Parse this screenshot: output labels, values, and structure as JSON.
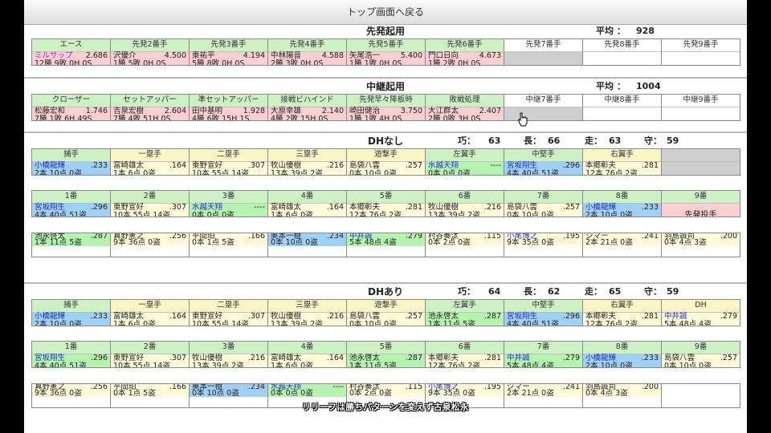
{
  "top_link": "トップ画面へ戻る",
  "starters": {
    "title": "先発起用",
    "avg_label": "平均 ：",
    "avg_value": "928",
    "cells": [
      {
        "header": "エース",
        "hc": "green",
        "bc": "pink",
        "name": "ミルサップ",
        "name_color": "magenta",
        "val1": "2.686",
        "line2": "12勝 9敗 0H 0S"
      },
      {
        "header": "先発2番手",
        "hc": "green",
        "bc": "pink",
        "name": "沢優介",
        "val1": "4.500",
        "line2": "1勝 5敗 0H 0S"
      },
      {
        "header": "先発3番手",
        "hc": "green",
        "bc": "pink",
        "name": "東祐平",
        "val1": "4.194",
        "line2": "5勝 8敗 0H 0S"
      },
      {
        "header": "先発4番手",
        "hc": "green",
        "bc": "pink",
        "name": "中林陽音",
        "val1": "4.588",
        "line2": "2勝 3敗 0H 0S"
      },
      {
        "header": "先発5番手",
        "hc": "green",
        "bc": "pink",
        "name": "矢尾浩一",
        "val1": "5.400",
        "line2": "1勝 1敗 0H 0S"
      },
      {
        "header": "先発6番手",
        "hc": "green",
        "bc": "pink",
        "name": "門口日向",
        "val1": "4.673",
        "line2": "1勝 2敗 0H 0S"
      },
      {
        "header": "先発7番手",
        "hc": "white",
        "bc": "gray",
        "name": "",
        "val1": "",
        "line2": ""
      },
      {
        "header": "先発8番手",
        "hc": "white",
        "bc": "white",
        "name": "",
        "val1": "",
        "line2": ""
      },
      {
        "header": "先発9番手",
        "hc": "white",
        "bc": "white",
        "name": "",
        "val1": "",
        "line2": ""
      }
    ]
  },
  "relievers": {
    "title": "中継起用",
    "avg_label": "平均 ：",
    "avg_value": "1004",
    "cells": [
      {
        "header": "クローザー",
        "hc": "green",
        "bc": "pink",
        "name": "松藤宏和",
        "val1": "1.746",
        "line2": "7勝 1敗 6H 49S"
      },
      {
        "header": "セットアッパー",
        "hc": "green",
        "bc": "pink",
        "name": "吉泉宏樹",
        "val1": "2.604",
        "line2": "7勝 4敗 51H 0S"
      },
      {
        "header": "準セットアッパー",
        "hc": "green",
        "bc": "pink",
        "name": "田中基明",
        "val1": "1.928",
        "line2": "4勝 6敗 15H 1S"
      },
      {
        "header": "接戦ビハインド",
        "hc": "green",
        "bc": "pink",
        "name": "大原幸雄",
        "val1": "2.140",
        "line2": "4勝 2敗 15H 0S"
      },
      {
        "header": "先発早々降板時",
        "hc": "green",
        "bc": "pink",
        "name": "崎田健治",
        "val1": "3.750",
        "line2": "1勝 1敗 4H 0S"
      },
      {
        "header": "敗戦処理",
        "hc": "green",
        "bc": "pink",
        "name": "大江群太",
        "val1": "2.407",
        "line2": "2勝 0敗 3H 0S"
      },
      {
        "header": "中継7番手",
        "hc": "white",
        "bc": "gray",
        "name": "",
        "val1": "",
        "line2": ""
      },
      {
        "header": "中継8番手",
        "hc": "white",
        "bc": "white",
        "name": "",
        "val1": "",
        "line2": ""
      },
      {
        "header": "中継9番手",
        "hc": "white",
        "bc": "white",
        "name": "",
        "val1": "",
        "line2": ""
      }
    ]
  },
  "dh_none": {
    "title": "DHなし",
    "stats": [
      {
        "label": "巧：",
        "value": "63"
      },
      {
        "label": "長：",
        "value": "66"
      },
      {
        "label": "走：",
        "value": "63"
      },
      {
        "label": "守：",
        "value": "59"
      }
    ],
    "positions": [
      {
        "header": "捕手",
        "hc": "green",
        "bc": "blue",
        "name": "小橋龍輝",
        "name_color": "blue",
        "val1": ".233",
        "line2": "2本 10点 0盗"
      },
      {
        "header": "一塁手",
        "hc": "yellow",
        "bc": "yellow",
        "name": "富崎雄太",
        "val1": ".164",
        "line2": "1本 6点 0盗"
      },
      {
        "header": "二塁手",
        "hc": "yellow",
        "bc": "yellow",
        "name": "東野宣好",
        "val1": ".307",
        "line2": "10本 55点 14盗"
      },
      {
        "header": "三塁手",
        "hc": "yellow",
        "bc": "yellow",
        "name": "牧山優樹",
        "val1": ".216",
        "line2": "13本 39点 2盗"
      },
      {
        "header": "遊撃手",
        "hc": "yellow",
        "bc": "yellow",
        "name": "島袋八雲",
        "val1": ".257",
        "line2": "0本 10点 0盗"
      },
      {
        "header": "左翼手",
        "hc": "green",
        "bc": "green",
        "name": "水越天翔",
        "name_color": "blue",
        "val1": "----",
        "line2": "0本 0点 0盗"
      },
      {
        "header": "中堅手",
        "hc": "green",
        "bc": "blue",
        "name": "宮坂翔生",
        "name_color": "blue",
        "val1": ".296",
        "line2": "4本 40点 51盗"
      },
      {
        "header": "右翼手",
        "hc": "yellow",
        "bc": "yellow",
        "name": "本郷彰夫",
        "val1": ".281",
        "line2": "12本 76点 2盗"
      },
      {
        "header": "",
        "hc": "gray",
        "bc": "gray",
        "name": "",
        "val1": "",
        "line2": ""
      }
    ],
    "order": [
      {
        "header": "1番",
        "hc": "green",
        "bc": "blue",
        "name": "宮坂翔生",
        "name_color": "blue",
        "val1": ".296",
        "line2": "4本 40点 51盗"
      },
      {
        "header": "2番",
        "hc": "green",
        "bc": "yellow",
        "name": "東野宣好",
        "val1": ".307",
        "line2": "10本 55点 14盗"
      },
      {
        "header": "3番",
        "hc": "green",
        "bc": "green",
        "name": "水越天翔",
        "name_color": "blue",
        "val1": "----",
        "line2": "0本 0点 0盗"
      },
      {
        "header": "4番",
        "hc": "green",
        "bc": "yellow",
        "name": "富崎雄太",
        "val1": ".164",
        "line2": "1本 6点 0盗"
      },
      {
        "header": "5番",
        "hc": "green",
        "bc": "yellow",
        "name": "本郷彰夫",
        "val1": ".281",
        "line2": "12本 76点 2盗"
      },
      {
        "header": "6番",
        "hc": "green",
        "bc": "yellow",
        "name": "牧山優樹",
        "val1": ".216",
        "line2": "13本 39点 2盗"
      },
      {
        "header": "7番",
        "hc": "green",
        "bc": "yellow",
        "name": "島袋八雲",
        "val1": ".257",
        "line2": "0本 10点 0盗"
      },
      {
        "header": "8番",
        "hc": "green",
        "bc": "blue",
        "name": "小橋龍輝",
        "name_color": "blue",
        "val1": ".233",
        "line2": "2本 10点 0盗"
      },
      {
        "header": "9番",
        "hc": "green",
        "bc": "pinkfull",
        "label": "先発投手"
      }
    ],
    "bench": [
      {
        "bc": "green",
        "name": "池永啓太",
        "val1": ".287",
        "line2": "1本 11点 5盗"
      },
      {
        "bc": "yellow",
        "name": "真野憲之",
        "val1": ".256",
        "line2": "9本 36点 0盗"
      },
      {
        "bc": "yellow",
        "name": "平間珀",
        "val1": ".166",
        "line2": "0本 1点 5盗"
      },
      {
        "bc": "blue",
        "name": "奥本一樹",
        "val1": ".234",
        "line2": "0本 10点 0盗"
      },
      {
        "bc": "green",
        "name": "中井誠",
        "name_color": "blue",
        "val1": ".279",
        "line2": "5本 48点 4盗"
      },
      {
        "bc": "yellow",
        "name": "村谷奏汰",
        "val1": ".115",
        "line2": "0本 2点 0盗"
      },
      {
        "bc": "yellow",
        "name": "小尾博之",
        "name_color": "blue",
        "val1": ".195",
        "line2": "9本 35点 0盗"
      },
      {
        "bc": "yellow",
        "name": "ジマー",
        "val1": ".241",
        "line2": "2本 21点 0盗"
      },
      {
        "bc": "yellow",
        "name": "羽島誠司",
        "val1": ".200",
        "line2": "0本 4点 3盗"
      }
    ]
  },
  "dh_yes": {
    "title": "DHあり",
    "stats": [
      {
        "label": "巧：",
        "value": "64"
      },
      {
        "label": "長：",
        "value": "62"
      },
      {
        "label": "走：",
        "value": "65"
      },
      {
        "label": "守：",
        "value": "59"
      }
    ],
    "positions": [
      {
        "header": "捕手",
        "hc": "green",
        "bc": "blue",
        "name": "小橋龍輝",
        "name_color": "blue",
        "val1": ".233",
        "line2": "2本 10点 0盗"
      },
      {
        "header": "一塁手",
        "hc": "yellow",
        "bc": "yellow",
        "name": "富崎雄太",
        "val1": ".164",
        "line2": "1本 6点 0盗"
      },
      {
        "header": "二塁手",
        "hc": "yellow",
        "bc": "yellow",
        "name": "東野宣好",
        "val1": ".307",
        "line2": "10本 55点 14盗"
      },
      {
        "header": "三塁手",
        "hc": "yellow",
        "bc": "yellow",
        "name": "牧山優樹",
        "val1": ".216",
        "line2": "13本 39点 2盗"
      },
      {
        "header": "遊撃手",
        "hc": "yellow",
        "bc": "yellow",
        "name": "島袋八雲",
        "val1": ".257",
        "line2": "0本 10点 0盗"
      },
      {
        "header": "左翼手",
        "hc": "green",
        "bc": "green",
        "name": "池永啓太",
        "val1": ".287",
        "line2": "1本 11点 5盗"
      },
      {
        "header": "中堅手",
        "hc": "green",
        "bc": "blue",
        "name": "宮坂翔生",
        "name_color": "blue",
        "val1": ".296",
        "line2": "4本 40点 51盗"
      },
      {
        "header": "右翼手",
        "hc": "yellow",
        "bc": "yellow",
        "name": "本郷彰夫",
        "val1": ".281",
        "line2": "12本 76点 2盗"
      },
      {
        "header": "DH",
        "hc": "yellow",
        "bc": "yellow",
        "name": "中井誠",
        "name_color": "blue",
        "val1": ".279",
        "line2": "5本 48点 4盗"
      }
    ],
    "order": [
      {
        "header": "1番",
        "hc": "green",
        "bc": "green",
        "name": "宮坂翔生",
        "name_color": "blue",
        "val1": ".296",
        "line2": "4本 40点 51盗"
      },
      {
        "header": "2番",
        "hc": "green",
        "bc": "yellow",
        "name": "東野宣好",
        "val1": ".307",
        "line2": "10本 55点 14盗"
      },
      {
        "header": "3番",
        "hc": "green",
        "bc": "yellow",
        "name": "牧山優樹",
        "val1": ".216",
        "line2": "13本 39点 2盗"
      },
      {
        "header": "4番",
        "hc": "green",
        "bc": "yellow",
        "name": "富崎雄太",
        "val1": ".164",
        "line2": "1本 6点 0盗"
      },
      {
        "header": "5番",
        "hc": "green",
        "bc": "green",
        "name": "池永啓太",
        "val1": ".287",
        "line2": "1本 11点 5盗"
      },
      {
        "header": "6番",
        "hc": "green",
        "bc": "yellow",
        "name": "本郷彰夫",
        "val1": ".281",
        "line2": "12本 76点 2盗"
      },
      {
        "header": "7番",
        "hc": "green",
        "bc": "green",
        "name": "中井誠",
        "name_color": "blue",
        "val1": ".279",
        "line2": "5本 48点 4盗"
      },
      {
        "header": "8番",
        "hc": "green",
        "bc": "blue",
        "name": "小橋龍輝",
        "name_color": "blue",
        "val1": ".233",
        "line2": "2本 10点 0盗"
      },
      {
        "header": "9番",
        "hc": "green",
        "bc": "yellow",
        "name": "島袋八雲",
        "val1": ".257",
        "line2": "0本 10点 0盗"
      }
    ],
    "bench": [
      {
        "bc": "yellow",
        "name": "真野憲之",
        "val1": ".256",
        "line2": "9本 36点 0盗"
      },
      {
        "bc": "yellow",
        "name": "平間珀",
        "val1": ".166",
        "line2": "0本 1点 5盗"
      },
      {
        "bc": "blue",
        "name": "奥本一樹",
        "val1": ".234",
        "line2": "0本 10点 0盗"
      },
      {
        "bc": "green",
        "name": "水越天翔",
        "name_color": "blue",
        "val1": "----",
        "line2": "0本 0点 0盗"
      },
      {
        "bc": "yellow",
        "name": "村谷奏汰",
        "val1": ".115",
        "line2": "0本 2点 0盗"
      },
      {
        "bc": "yellow",
        "name": "小尾博之",
        "name_color": "blue",
        "val1": ".195",
        "line2": "9本 35点 0盗"
      },
      {
        "bc": "yellow",
        "name": "ジマー",
        "val1": ".241",
        "line2": "2本 21点 0盗"
      },
      {
        "bc": "yellow",
        "name": "羽島誠司",
        "val1": ".200",
        "line2": "0本 4点 3盗"
      },
      {
        "bc": "white",
        "name": "",
        "val1": "",
        "line2": ""
      }
    ]
  },
  "subtitle": "リリーフは勝ちパターンを変えず古泉松永"
}
